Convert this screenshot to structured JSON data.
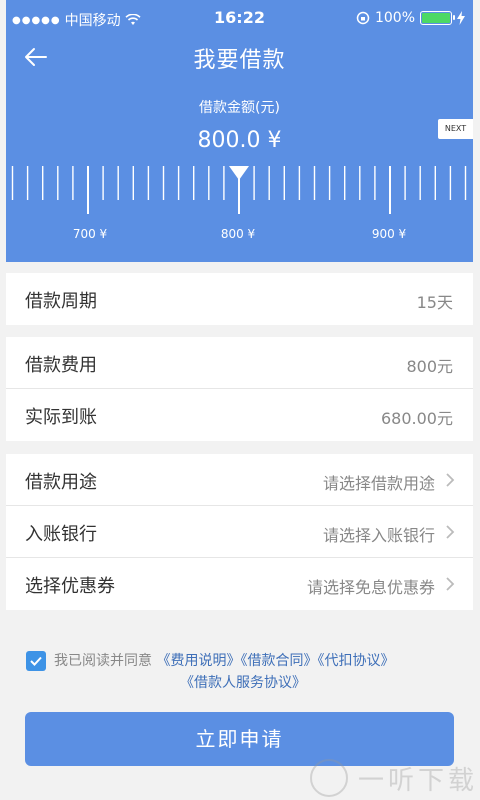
{
  "status": {
    "carrier": "中国移动",
    "time": "16:22",
    "battery": "100%"
  },
  "header": {
    "title": "我要借款",
    "amount_label": "借款金额(元)",
    "amount": "800.0 ¥",
    "next_label": "NEXT",
    "slider_value": 800,
    "scale_labels": [
      "700 ¥",
      "800 ¥",
      "900 ¥"
    ]
  },
  "section1": {
    "rows": [
      {
        "label": "借款周期",
        "value": "15天"
      }
    ]
  },
  "section2": {
    "rows": [
      {
        "label": "借款费用",
        "value": "800元"
      },
      {
        "label": "实际到账",
        "value": "680.00元"
      }
    ]
  },
  "section3": {
    "rows": [
      {
        "label": "借款用途",
        "value": "请选择借款用途"
      },
      {
        "label": "入账银行",
        "value": "请选择入账银行"
      },
      {
        "label": "选择优惠券",
        "value": "请选择免息优惠券"
      }
    ]
  },
  "agreement": {
    "checked": true,
    "prefix": "我已阅读并同意",
    "link1": "《费用说明》",
    "link2": "《借款合同》",
    "link3": "《代扣协议》",
    "link4": "《借款人服务协议》"
  },
  "submit_label": "立即申请",
  "watermark": "一听下载",
  "colors": {
    "primary": "#5b8fe3",
    "link": "#3e6fb8",
    "checkbox": "#3e93e6",
    "battery": "#4cd964"
  }
}
